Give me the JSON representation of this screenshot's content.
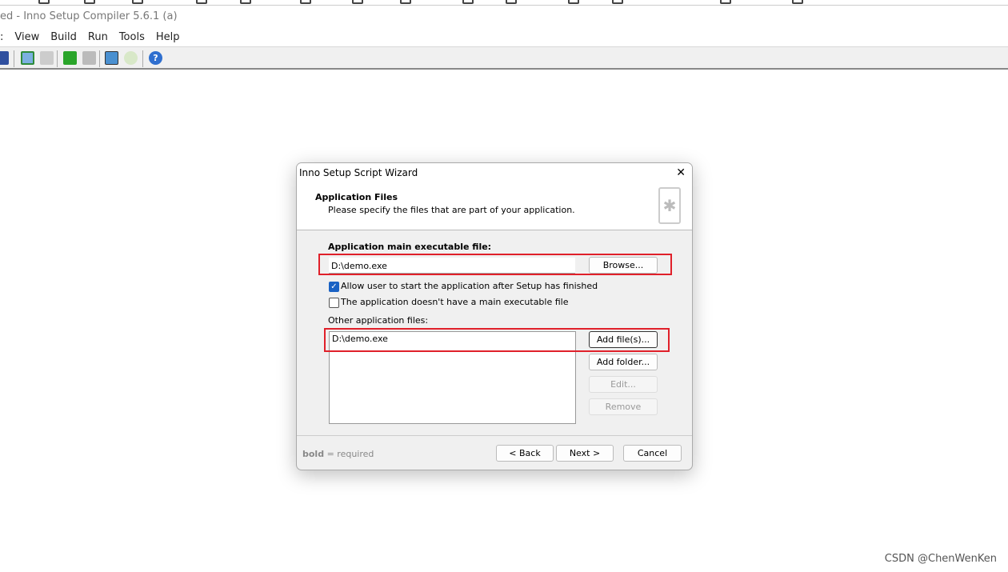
{
  "app": {
    "title": "ed - Inno Setup Compiler 5.6.1 (a)",
    "menu": [
      ":",
      "View",
      "Build",
      "Run",
      "Tools",
      "Help"
    ]
  },
  "toolbar": {
    "icons": [
      "save-icon",
      "compile-icon",
      "stop-compile-icon",
      "run-icon",
      "pause-icon",
      "wizard-icon",
      "refresh-icon",
      "help-icon"
    ]
  },
  "dialog": {
    "title": "Inno Setup Script Wizard",
    "close": "✕",
    "header_title": "Application Files",
    "header_subtitle": "Please specify the files that are part of your application.",
    "main_exe_label": "Application main executable file:",
    "main_exe_value": "D:\\demo.exe",
    "browse": "Browse...",
    "allow_start_label": "Allow user to start the application after Setup has finished",
    "allow_start_checked": true,
    "no_main_exe_label": "The application doesn't have a main executable file",
    "no_main_exe_checked": false,
    "other_files_label": "Other application files:",
    "other_files": [
      "D:\\demo.exe"
    ],
    "add_files": "Add file(s)...",
    "add_folder": "Add folder...",
    "edit": "Edit...",
    "remove": "Remove",
    "legend_bold": "bold",
    "legend_rest": " = required",
    "back": "< Back",
    "next": "Next >",
    "cancel": "Cancel"
  },
  "watermark": "CSDN @ChenWenKen",
  "colors": {
    "highlight": "#e0202a",
    "checkbox": "#1a62c4"
  }
}
